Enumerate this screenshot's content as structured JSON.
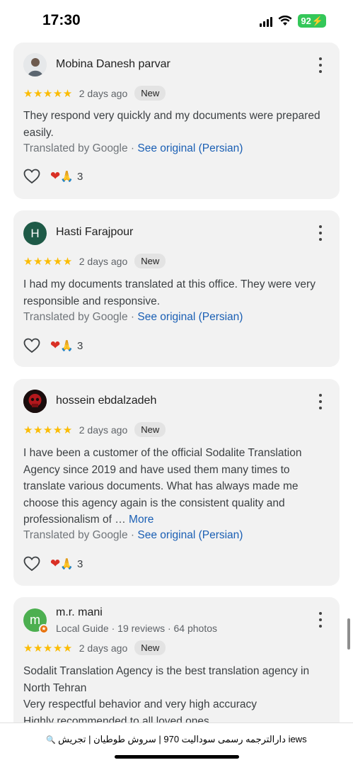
{
  "status": {
    "time": "17:30",
    "battery": "92"
  },
  "reviews": [
    {
      "author": "Mobina Danesh parvar",
      "stars": "★★★★★",
      "date": "2 days ago",
      "badge": "New",
      "text": "They respond very quickly and my documents were prepared easily.",
      "translated_by": "Translated by Google ·",
      "see_original": "See original (Persian)",
      "reactions": "3"
    },
    {
      "author": "Hasti Farajpour",
      "avatar_letter": "H",
      "stars": "★★★★★",
      "date": "2 days ago",
      "badge": "New",
      "text": "I had my documents translated at this office. They were very responsible and responsive.",
      "translated_by": "Translated by Google ·",
      "see_original": "See original (Persian)",
      "reactions": "3"
    },
    {
      "author": "hossein ebdalzadeh",
      "stars": "★★★★★",
      "date": "2 days ago",
      "badge": "New",
      "text": "I have been a customer of the official Sodalite Translation Agency since 2019 and have used them many times to translate various documents. What has always made me choose this agency again is the consistent quality and professionalism of …",
      "more": "More",
      "translated_by": "Translated by Google ·",
      "see_original": "See original (Persian)",
      "reactions": "3"
    },
    {
      "author": "m.r. mani",
      "avatar_letter": "m",
      "meta": "Local Guide · 19 reviews · 64 photos",
      "stars": "★★★★★",
      "date": "2 days ago",
      "badge": "New",
      "line1": "Sodalit Translation Agency is the best translation agency in North Tehran",
      "line2": "Very respectful behavior and very high accuracy",
      "line3": "Highly recommended to all loved ones"
    }
  ],
  "bottom_bar": {
    "url": "دارالترجمه رسمی سودالیت 970 | سروش طوطیان | تجریش iews"
  },
  "colors": {
    "star": "#fbbc04",
    "link": "#1a5fb4",
    "card_bg": "#f2f2f2",
    "avatar_h": "#1e5a47",
    "avatar_m": "#4caf50"
  }
}
